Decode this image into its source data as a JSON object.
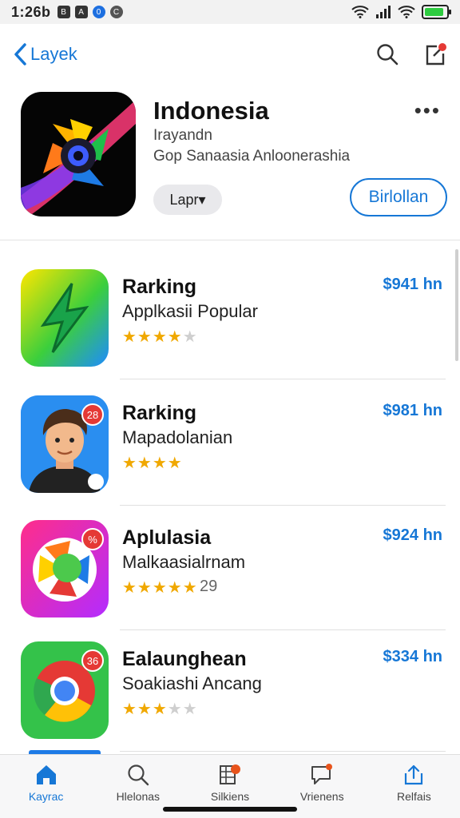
{
  "status": {
    "time": "1:26b",
    "icons": [
      "B",
      "A",
      "0",
      "C"
    ]
  },
  "nav": {
    "back_label": "Layek"
  },
  "hero": {
    "title": "Indonesia",
    "subtitle1": "Irayandn",
    "subtitle2": "Gop Sanaasia Anloonerashia",
    "pill_label": "Lapr▾",
    "get_label": "Birlollan"
  },
  "apps": [
    {
      "name": "Rarking",
      "subtitle": "Applkasii Popular",
      "stars": 4,
      "rating_count": "",
      "price": "$941 hn",
      "badge": ""
    },
    {
      "name": "Rarking",
      "subtitle": "Mapadolanian",
      "stars": 4,
      "rating_count": "",
      "price": "$981 hn",
      "badge": "28"
    },
    {
      "name": "Aplulasia",
      "subtitle": "Malkaasialrnam",
      "stars": 5,
      "rating_count": "29",
      "price": "$924 hn",
      "badge": "%"
    },
    {
      "name": "Ealaunghean",
      "subtitle": "Soakiashi Ancang",
      "stars": 3,
      "rating_count": "",
      "price": "$334 hn",
      "badge": "36"
    }
  ],
  "tabs": [
    {
      "label": "Kayrac",
      "icon": "home-icon",
      "active": true
    },
    {
      "label": "Hlelonas",
      "icon": "search-icon",
      "active": false
    },
    {
      "label": "Silkiens",
      "icon": "apps-icon",
      "active": false
    },
    {
      "label": "Vrienens",
      "icon": "message-icon",
      "active": false
    },
    {
      "label": "Relfais",
      "icon": "share-icon",
      "active": false
    }
  ],
  "colors": {
    "accent": "#1677d6",
    "badge": "#e53935",
    "star": "#f0a800"
  }
}
